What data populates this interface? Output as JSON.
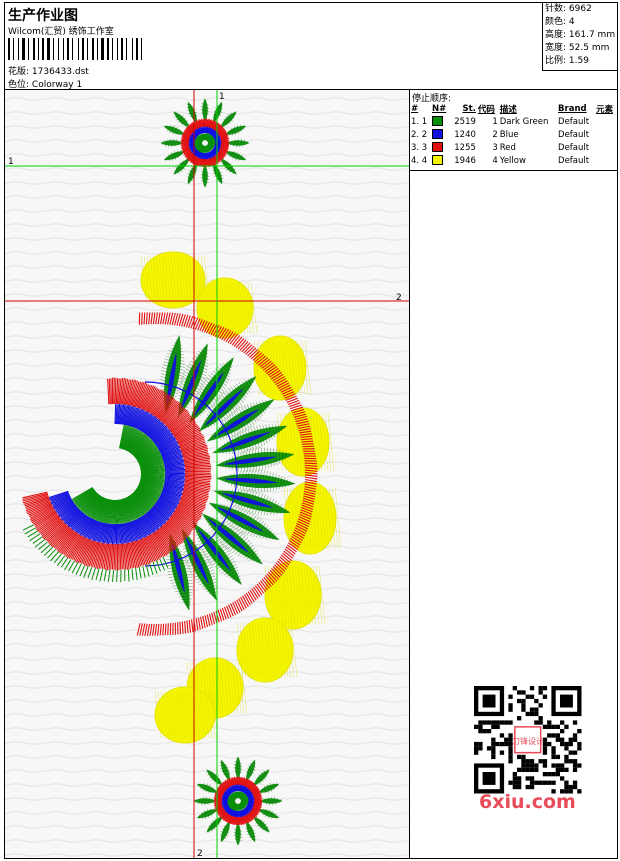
{
  "header": {
    "title": "生产作业图",
    "company": "Wilcom(汇贸) 绣饰工作室",
    "pattern_label": "花版:",
    "pattern_value": "1736433.dst",
    "color_label": "色位:",
    "color_value": "Colorway 1"
  },
  "stats": {
    "stitches_label": "针数:",
    "stitches": "6962",
    "colors_label": "颜色:",
    "colors": "4",
    "height_label": "高度:",
    "height": "161.7 mm",
    "width_label": "宽度:",
    "width": "52.5 mm",
    "scale_label": "比例:",
    "scale": "1.59"
  },
  "color_panel": {
    "stop_title": "停止顺序:",
    "columns": [
      "#",
      "N#",
      "St.",
      "代码",
      "描述",
      "Brand",
      "元素"
    ],
    "rows": [
      {
        "idx": "1. 1",
        "swatch": "#0a8f0a",
        "st": "2519",
        "code": "1",
        "desc": "Dark Green",
        "brand": "Default"
      },
      {
        "idx": "2. 2",
        "swatch": "#1010e0",
        "st": "1240",
        "code": "2",
        "desc": "Blue",
        "brand": "Default"
      },
      {
        "idx": "3. 3",
        "swatch": "#e01010",
        "st": "1255",
        "code": "3",
        "desc": "Red",
        "brand": "Default"
      },
      {
        "idx": "4. 4",
        "swatch": "#f5f500",
        "st": "1946",
        "code": "4",
        "desc": "Yellow",
        "brand": "Default"
      }
    ]
  },
  "guides": {
    "h1_label": "1",
    "h2_label": "2",
    "v1_label": "1",
    "v2_label": "2"
  },
  "watermark": {
    "text": "6xiu.com",
    "qr_label": "刀锋设计"
  },
  "colors": {
    "green": "#0a8f0a",
    "blue": "#1010e0",
    "red": "#e01010",
    "yellow": "#f5f500",
    "guide_green": "#00d000",
    "guide_red": "#d00000"
  }
}
